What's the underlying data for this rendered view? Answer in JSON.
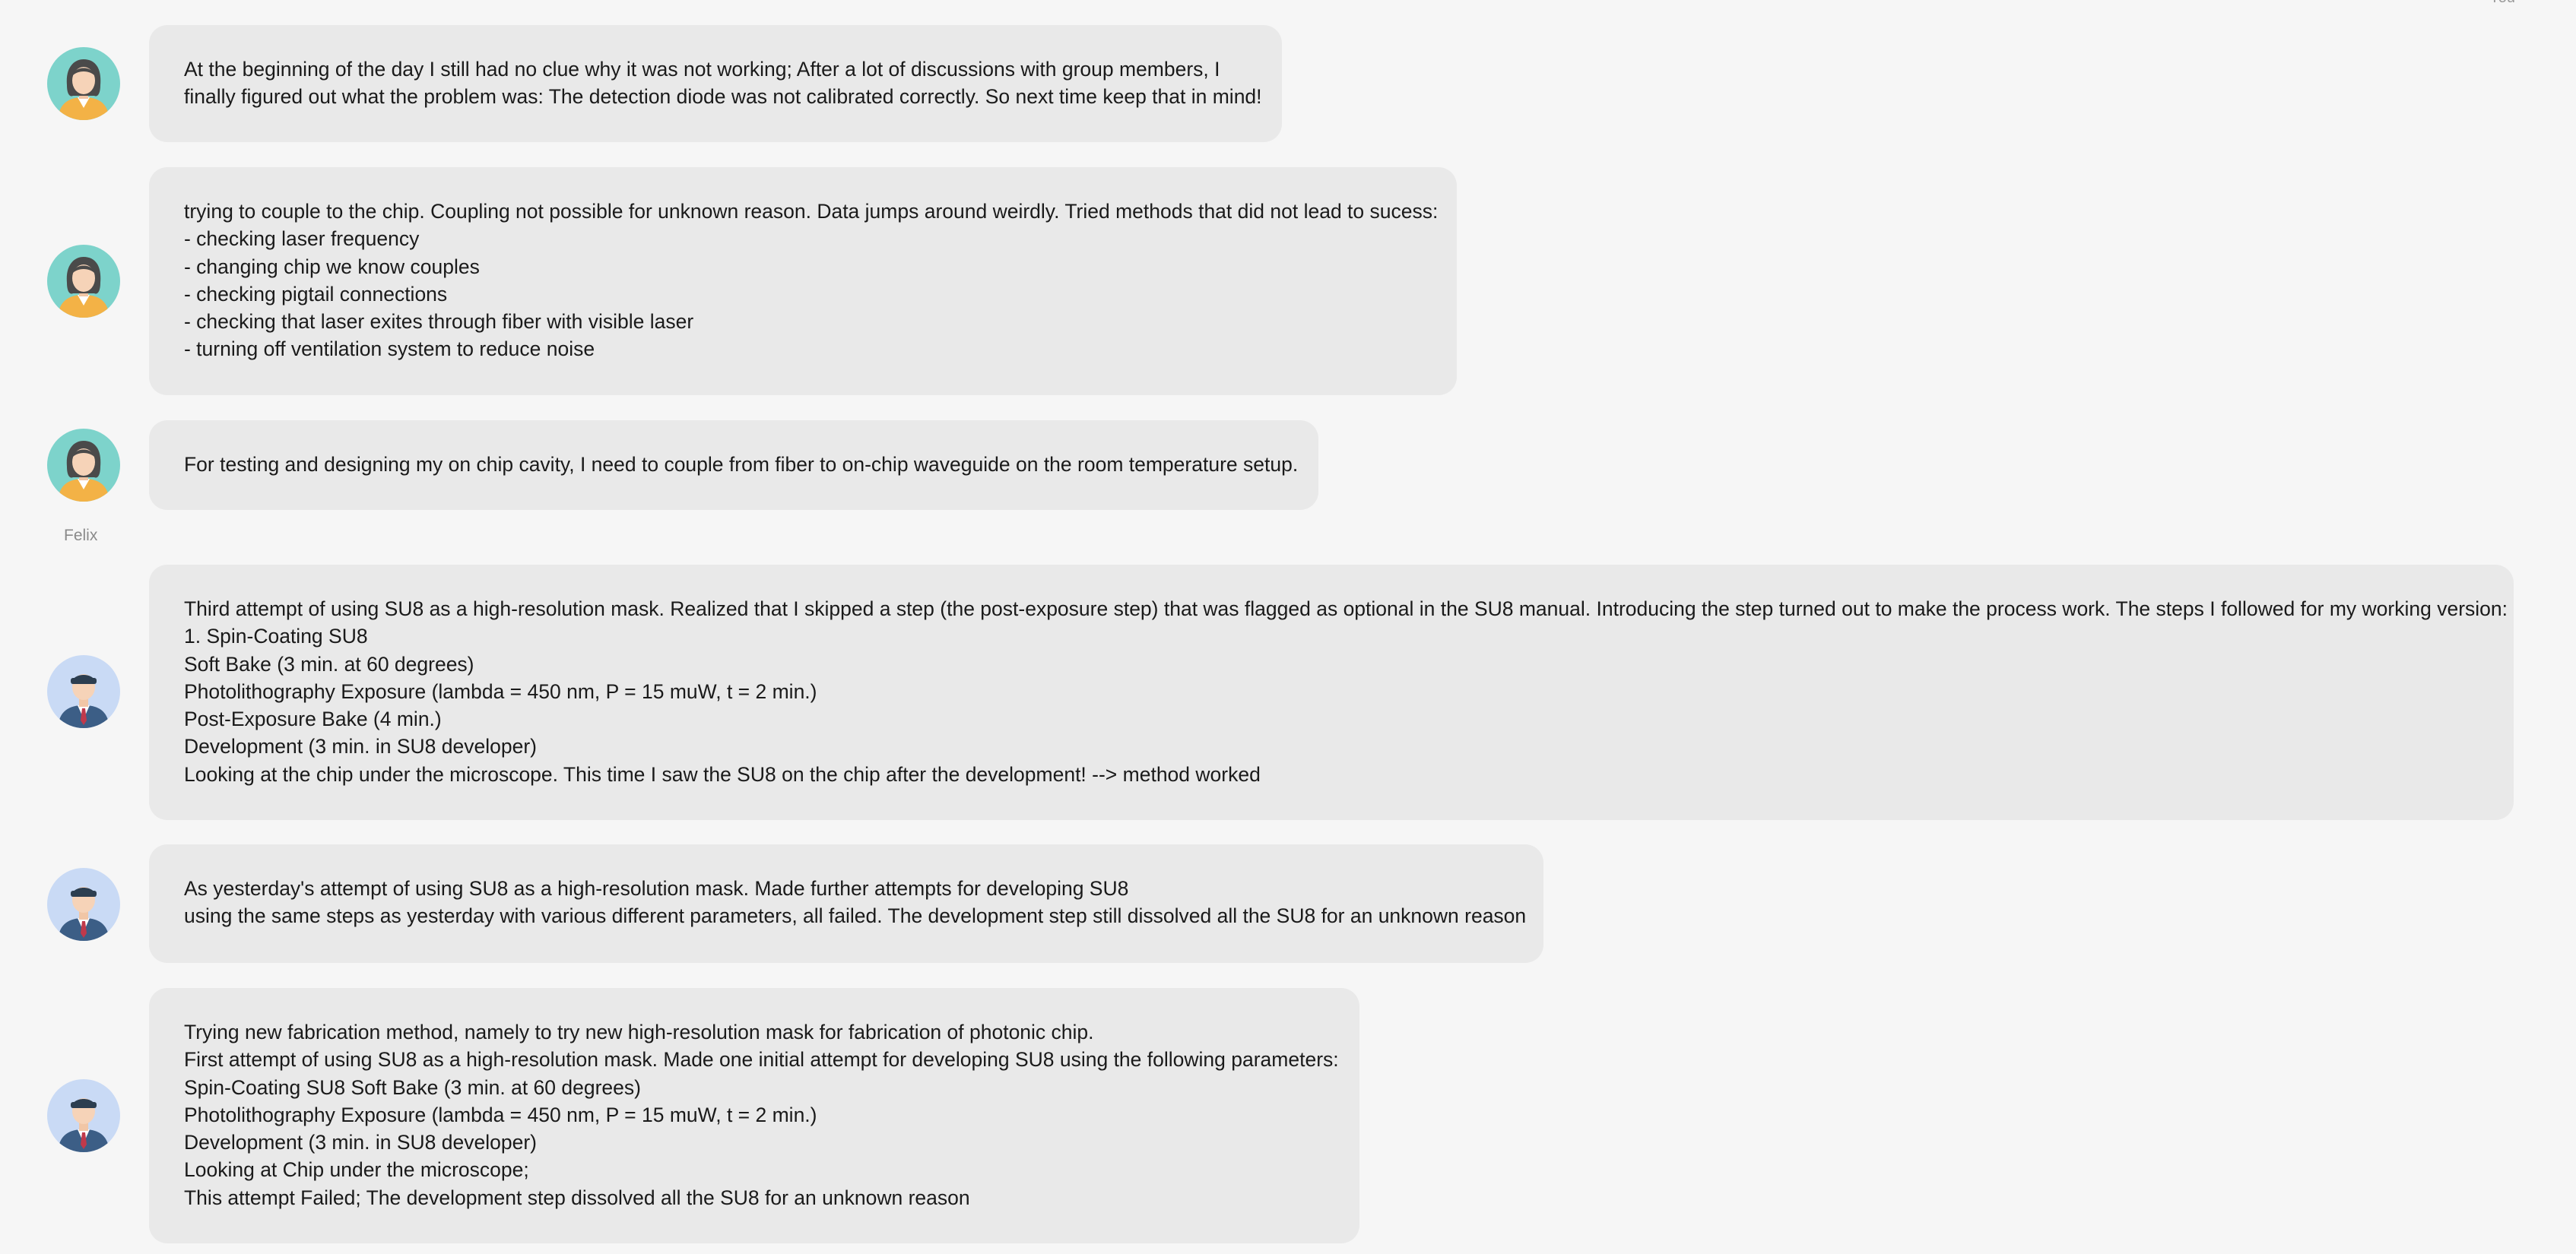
{
  "corner_label": "You",
  "author_felix": "Felix",
  "messages": [
    {
      "avatar": "female-avatar-icon",
      "lines": [
        "At the beginning of the day I still had no clue why it was not working; After a lot of discussions with group members, I",
        "finally figured out what the problem was: The detection diode was not calibrated correctly. So next time keep that in mind!"
      ]
    },
    {
      "avatar": "female-avatar-icon",
      "lines": [
        "trying to couple to the chip. Coupling not possible for unknown reason. Data jumps around weirdly. Tried methods that did not lead to sucess:",
        "- checking laser frequency",
        "- changing chip we know couples",
        "- checking pigtail connections",
        "- checking that laser exites through fiber with visible laser",
        "- turning off ventilation system to reduce noise"
      ]
    },
    {
      "avatar": "female-avatar-icon",
      "lines": [
        "For testing and designing my on chip cavity, I need to couple from fiber to on-chip waveguide on the room temperature setup."
      ]
    },
    {
      "avatar": "male-avatar-icon",
      "lines": [
        "Third attempt of using SU8 as a high-resolution mask. Realized that I skipped a step (the post-exposure step) that was flagged as optional in the SU8 manual. Introducing the step turned out to make the process work. The steps I followed for my working version:",
        "1. Spin-Coating SU8",
        "Soft Bake (3 min. at 60 degrees)",
        "Photolithography Exposure (lambda = 450 nm, P = 15 muW, t = 2 min.)",
        "Post-Exposure Bake (4 min.)",
        "Development (3 min. in SU8 developer)",
        "Looking at the chip under the microscope. This time I saw the SU8 on the chip after the development! --> method worked"
      ]
    },
    {
      "avatar": "male-avatar-icon",
      "lines": [
        "As yesterday's attempt of using SU8 as a high-resolution mask. Made further attempts for developing SU8",
        "using the same steps as yesterday with various different parameters, all failed. The development step still dissolved all the SU8 for an unknown reason"
      ]
    },
    {
      "avatar": "male-avatar-icon",
      "lines": [
        "Trying new fabrication method, namely to try new high-resolution mask for fabrication of photonic chip.",
        "First attempt of using SU8 as a high-resolution mask. Made one initial attempt for developing SU8 using the following parameters:",
        "Spin-Coating SU8 Soft Bake (3 min. at 60 degrees)",
        "Photolithography Exposure (lambda = 450 nm, P = 15 muW, t = 2 min.)",
        "Development (3 min. in SU8 developer)",
        "Looking at Chip under the microscope;",
        "This attempt Failed; The development step dissolved all the SU8 for an unknown reason"
      ]
    }
  ],
  "colors": {
    "background": "#f6f6f6",
    "bubble": "#e9e9e9",
    "text": "#1a1a1a",
    "female_avatar_bg": "#7dd3cb",
    "male_avatar_bg": "#c9daf5"
  }
}
